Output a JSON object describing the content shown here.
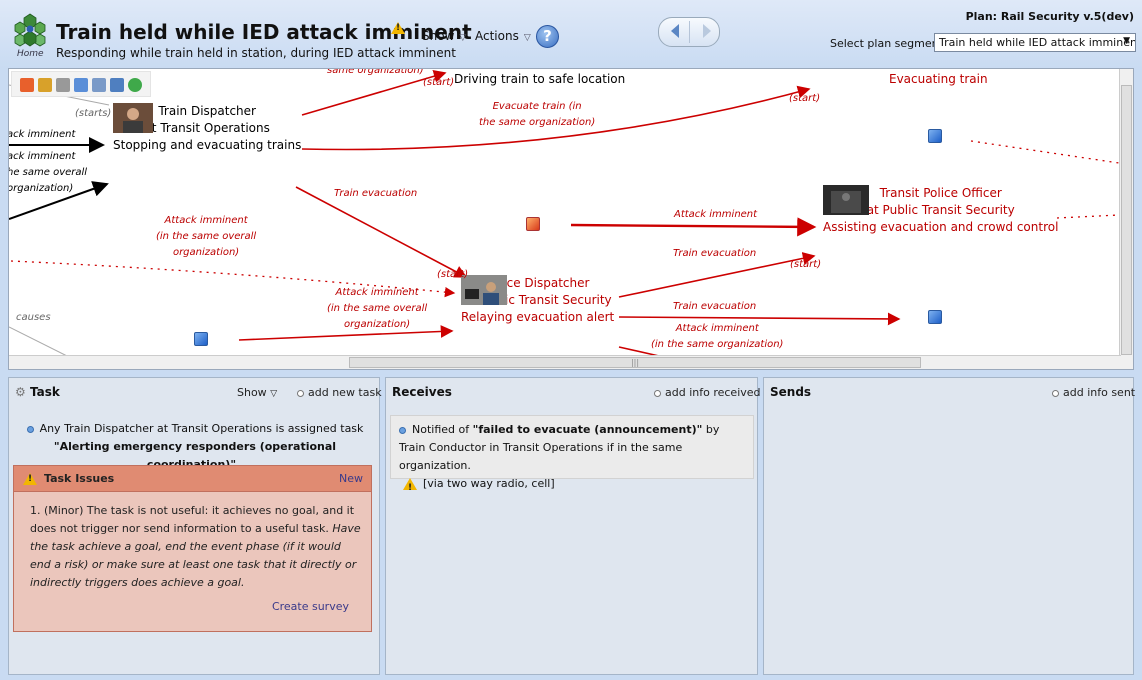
{
  "header": {
    "home_label": "Home",
    "title": "Train held while IED attack imminent",
    "subtitle": "Responding while train held in station, during IED attack imminent",
    "menu_show": "Show",
    "menu_actions": "Actions",
    "help": "?",
    "plan": "Plan: Rail Security v.5(dev)",
    "segment_label": "Select plan segment:",
    "segment_value": "Train held while IED attack imminent"
  },
  "diagram": {
    "nodes": {
      "train_dispatcher": [
        "Train Dispatcher",
        "at Transit Operations",
        "Stopping and evacuating trains"
      ],
      "driving": "Driving train to safe location",
      "evacuating": "Evacuating train",
      "transit_police": [
        "Transit Police Officer",
        "at Public Transit Security",
        "Assisting evacuation and crowd control"
      ],
      "police_dispatcher": [
        "Police Dispatcher",
        "at Public Transit Security",
        "Relaying evacuation alert"
      ]
    },
    "labels": {
      "same_org_top": "same organization)",
      "start1": "(start)",
      "start2": "(start)",
      "start3": "(start)",
      "start4": "(start)",
      "starts": "(starts)",
      "evacuate_train_1": "Evacuate train (in",
      "evacuate_train_2": "the same organization)",
      "left_1": "ack imminent",
      "left_2": "ack imminent",
      "left_3": "he same overall",
      "left_4": "organization)",
      "train_evacuation_a": "Train evacuation",
      "attack_imminent_a1": "Attack imminent",
      "attack_imminent_a2": "(in the same overall",
      "attack_imminent_a3": "organization)",
      "attack_imminent_b": "Attack imminent",
      "train_evacuation_b": "Train evacuation",
      "attack_imminent_c1": "Attack imminent",
      "attack_imminent_c2": "(in the same overall",
      "attack_imminent_c3": "organization)",
      "train_evacuation_c": "Train evacuation",
      "attack_imminent_d1": "Attack imminent",
      "attack_imminent_d2": "(in the same organization)",
      "causes": "causes"
    }
  },
  "task_panel": {
    "title": "Task",
    "show": "Show",
    "add_new": "add new task",
    "desc_1": "Any Train Dispatcher at Transit Operations is assigned task",
    "desc_2": "\"Alerting emergency responders (operational coordination)\"",
    "desc_3": " .",
    "issues_title": "Task Issues",
    "issues_new": "New",
    "issue_num": "1.",
    "issue_plain": "(Minor) The task is not useful: it achieves no goal, and it does not trigger nor send information to a useful task.",
    "issue_italic": "Have the task achieve a goal, end the event phase (if it would end a risk) or make sure at least one task that it directly or indirectly triggers does achieve a goal.",
    "create_survey": "Create survey"
  },
  "receives_panel": {
    "title": "Receives",
    "add": "add info received",
    "notified": "Notified of ",
    "what": "\"failed to evacuate (announcement)\"",
    "rest": " by Train Conductor in Transit Operations if in the same organization.",
    "via": "[via two way radio, cell]"
  },
  "sends_panel": {
    "title": "Sends",
    "add": "add info sent"
  }
}
